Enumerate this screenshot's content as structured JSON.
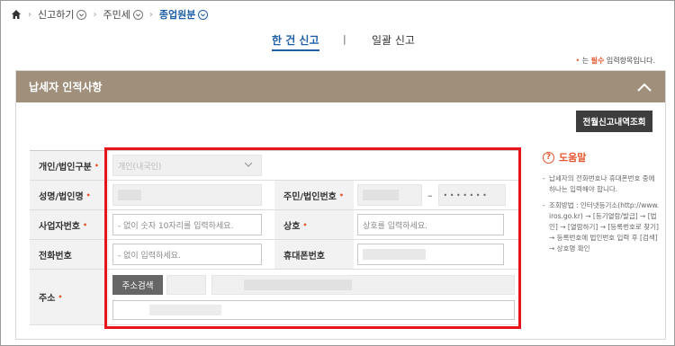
{
  "breadcrumb": {
    "items": [
      {
        "label": "신고하기"
      },
      {
        "label": "주민세"
      },
      {
        "label": "종업원분"
      }
    ]
  },
  "tabs": {
    "single": "한 건 신고",
    "divider": "|",
    "bulk": "일괄 신고"
  },
  "required_note": {
    "dot": "•",
    "prefix": "는 ",
    "emphasis": "필수",
    "suffix": " 입력항목입니다."
  },
  "panel": {
    "title": "납세자 인적사항",
    "history_button": "전월신고내역조회"
  },
  "form": {
    "req_mark": "•",
    "type_label": "개인/법인구분",
    "type_value": "개인(내국인)",
    "name_label": "성명/법인명",
    "id_label": "주민/법인번호",
    "id_dash": "–",
    "id_masked": "• • • • • • •",
    "bizno_label": "사업자번호",
    "bizno_placeholder": "- 없이 숫자 10자리를 입력하세요.",
    "trade_label": "상호",
    "trade_placeholder": "상호를 입력하세요.",
    "phone_label": "전화번호",
    "phone_placeholder": "- 없이 입력하세요.",
    "mobile_label": "휴대폰번호",
    "addr_label": "주소",
    "addr_button": "주소검색"
  },
  "help": {
    "title": "도움말",
    "items": [
      "납세자의 전화번호나 휴대폰번호 중에 하나는 입력해야 합니다.",
      "조회방법 : 인터넷등기소(http://www.iros.go.kr) → [등기열람/발급] → [법인] → [열람하기] → [등록번호로 찾기] → 등록번호에 법인번호 입력 후 [검색] → 상호명 확인"
    ]
  },
  "colors": {
    "panel_header": "#a0907b",
    "accent_blue": "#1e5fa8",
    "required_orange": "#e4572e",
    "highlight_red": "#e8141c"
  }
}
